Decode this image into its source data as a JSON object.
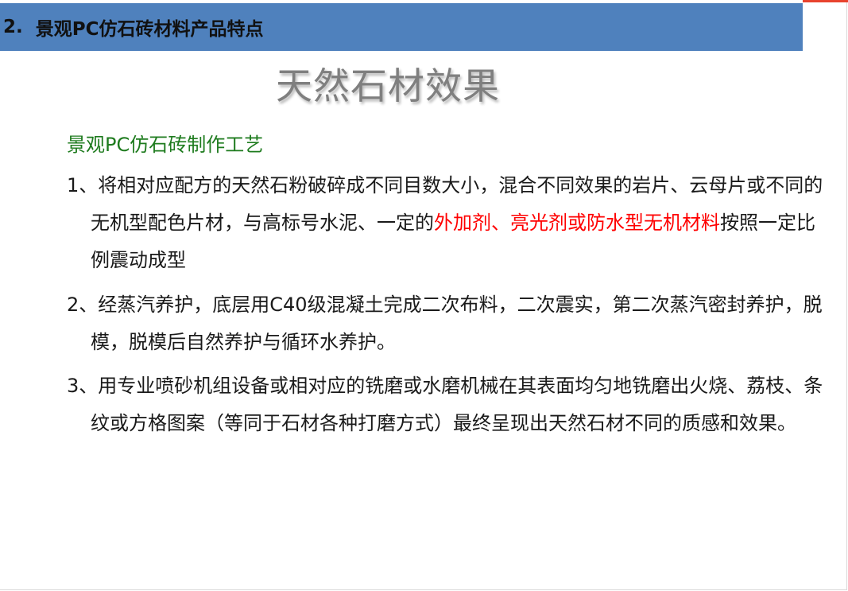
{
  "header": {
    "number": "2.",
    "title": "景观PC仿石砖材料产品特点",
    "bar_color": "#4f81bd"
  },
  "slide": {
    "title": "天然石材效果",
    "subtitle": "景观PC仿石砖制作工艺",
    "subtitle_color": "#1e7b1e",
    "highlight_color": "#ff0000"
  },
  "items": [
    {
      "number": "1、",
      "text_before": "将相对应配方的天然石粉破碎成不同目数大小，混合不同效果的岩片、云母片或不同的无机型配色片材，与高标号水泥、一定的",
      "highlight": "外加剂、亮光剂或防水型无机材料",
      "text_after": "按照一定比例震动成型"
    },
    {
      "number": "2、",
      "text": "经蒸汽养护，底层用C40级混凝土完成二次布料，二次震实，第二次蒸汽密封养护，脱模，脱模后自然养护与循环水养护。"
    },
    {
      "number": "3、",
      "text": "用专业喷砂机组设备或相对应的铣磨或水磨机械在其表面均匀地铣磨出火烧、荔枝、条纹或方格图案（等同于石材各种打磨方式）最终呈现出天然石材不同的质感和效果。"
    }
  ]
}
